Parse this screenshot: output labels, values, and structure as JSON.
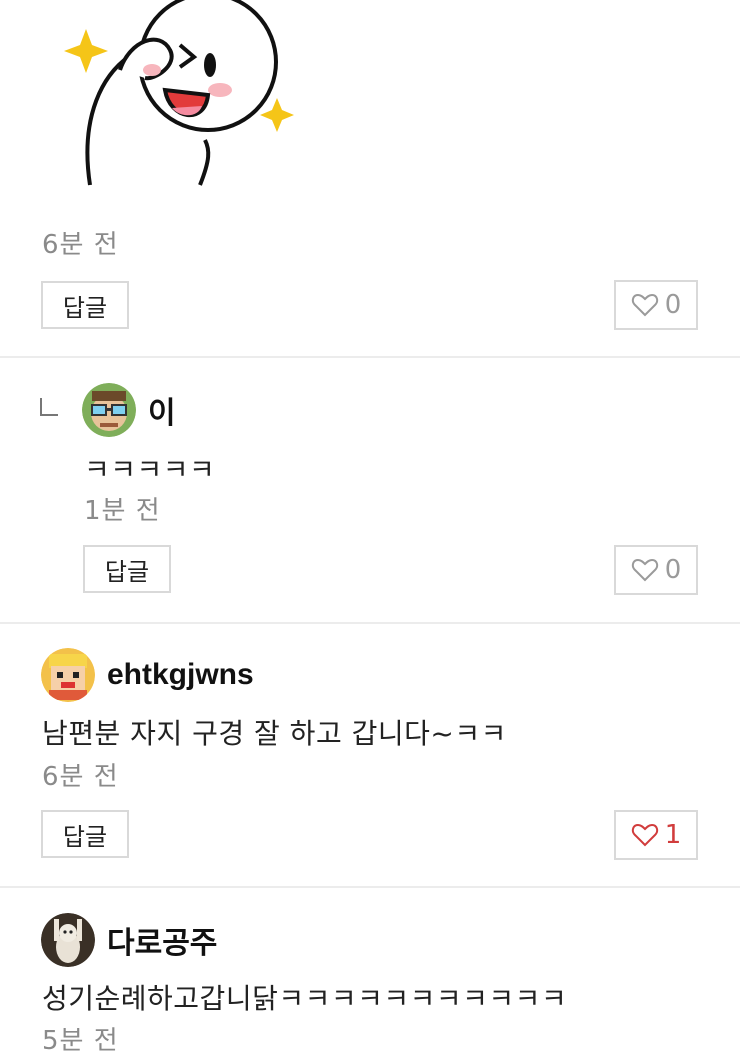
{
  "comments": [
    {
      "time": "6분 전",
      "reply_label": "답글",
      "like_count": "0",
      "liked": false
    },
    {
      "is_reply": true,
      "username": "이",
      "text": "ㅋㅋㅋㅋㅋ",
      "time": "1분 전",
      "reply_label": "답글",
      "like_count": "0",
      "liked": false
    },
    {
      "username": "ehtkgjwns",
      "text": "남편분 자지 구경 잘 하고 갑니다~ㅋㅋ",
      "time": "6분 전",
      "reply_label": "답글",
      "like_count": "1",
      "liked": true
    },
    {
      "username": "다로공주",
      "text": "성기순례하고갑니닭ㅋㅋㅋㅋㅋㅋㅋㅋㅋㅋㅋ",
      "time": "5분 전"
    }
  ],
  "colors": {
    "liked_heart": "#d13c3c",
    "unliked_heart": "#9a9a9a",
    "divider": "#ececec"
  },
  "icons": {
    "sticker": "cartoon-character-sticker",
    "like": "heart-icon",
    "reply_indicator": "reply-corner-icon"
  }
}
